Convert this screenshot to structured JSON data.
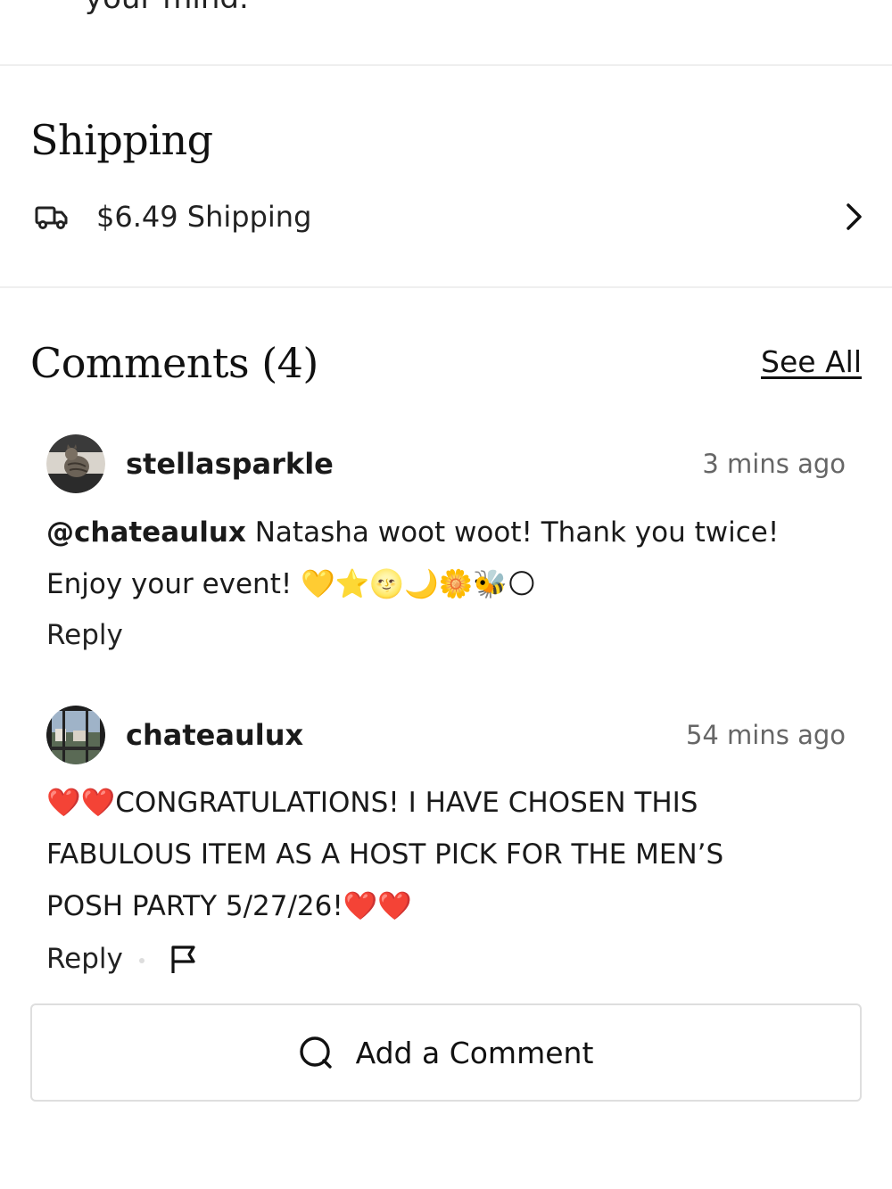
{
  "top_cut_text": "your mind.",
  "shipping": {
    "title": "Shipping",
    "label": "$6.49 Shipping",
    "icon": "truck-icon"
  },
  "comments": {
    "title": "Comments (4)",
    "see_all": "See All",
    "items": [
      {
        "username": "stellasparkle",
        "time": "3 mins ago",
        "mention": "@chateaulux",
        "text_line1": " Natasha woot woot! Thank you twice!",
        "text_line2": "Enjoy your event! 💛⭐🌝🌙🌼🐝🌕",
        "reply": "Reply"
      },
      {
        "username": "chateaulux",
        "time": "54 mins ago",
        "line1": "❤️❤️CONGRATULATIONS! I HAVE CHOSEN THIS",
        "line2": "FABULOUS ITEM AS A HOST PICK FOR THE MEN’S",
        "line3": "POSH PARTY 5/27/26!❤️❤️",
        "reply": "Reply"
      }
    ],
    "add_comment": "Add a Comment"
  }
}
